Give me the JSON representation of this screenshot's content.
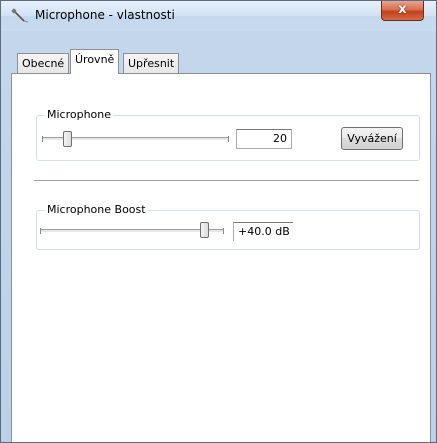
{
  "window": {
    "title": "Microphone - vlastnosti",
    "close_label": "x",
    "icon": "microphone-icon"
  },
  "tabs": [
    {
      "label": "Obecné",
      "active": false
    },
    {
      "label": "Úrovně",
      "active": true
    },
    {
      "label": "Upřesnit",
      "active": false
    }
  ],
  "microphone": {
    "label": "Microphone",
    "level": 20,
    "value_text": "20",
    "balance_label": "Vyvážení"
  },
  "boost": {
    "label": "Microphone Boost",
    "value_text": "+40.0 dB",
    "level_fraction": 1.0
  },
  "colors": {
    "close_button": "#c74a27",
    "frame": "#c3d6ec"
  }
}
